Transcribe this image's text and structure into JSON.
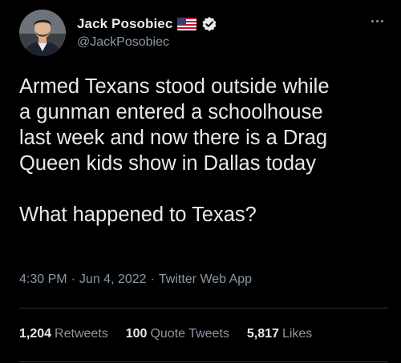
{
  "author": {
    "display_name": "Jack Posobiec",
    "handle": "@JackPosobiec",
    "flag_icon": "us-flag-icon",
    "verified_icon": "verified-badge-icon",
    "verified_color": "#e7e9ea"
  },
  "tweet": {
    "lines": [
      "Armed Texans stood outside while",
      "a gunman entered a schoolhouse",
      "last week and now there is a Drag",
      "Queen kids show in Dallas today"
    ],
    "closing_line": "What happened to Texas?"
  },
  "meta": {
    "time": "4:30 PM",
    "separator": "·",
    "date": "Jun 4, 2022",
    "source": "Twitter Web App"
  },
  "stats": {
    "retweets_count": "1,204",
    "retweets_label": "Retweets",
    "quotes_count": "100",
    "quotes_label": "Quote Tweets",
    "likes_count": "5,817",
    "likes_label": "Likes"
  },
  "colors": {
    "background": "#000000",
    "primary_text": "#e7e9ea",
    "secondary_text": "#8b98a5",
    "divider": "#2f3336"
  }
}
